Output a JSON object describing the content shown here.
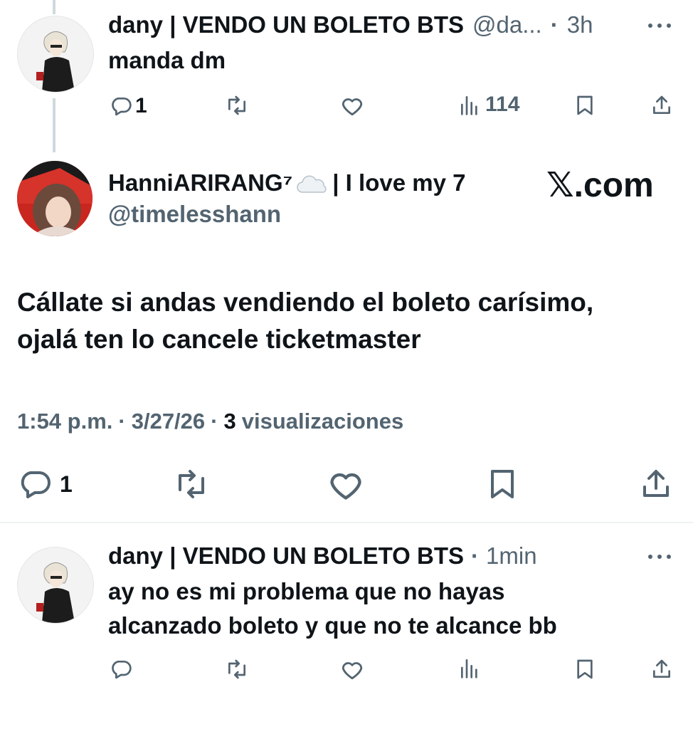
{
  "tweet1": {
    "display_name": "dany | VENDO UN BOLETO BTS",
    "handle": "@da...",
    "separator": "·",
    "time": "3h",
    "text": "manda dm",
    "reply_count": "1",
    "views": "114"
  },
  "main": {
    "display_name": "HanniARIRANG⁷",
    "name_suffix": "| I love my 7",
    "handle": "@timelesshann",
    "watermark": "𝕏.com",
    "text_line1": "Cállate si andas vendiendo el boleto carísimo,",
    "text_line2": "ojalá ten lo cancele ticketmaster",
    "time": "1:54 p.m.",
    "sep1": "·",
    "date": "3/27/26",
    "sep2": "·",
    "views_count": "3",
    "views_label": "visualizaciones",
    "reply_count": "1"
  },
  "tweet3": {
    "display_name": "dany | VENDO UN BOLETO BTS",
    "separator": "·",
    "time": "1min",
    "text_line1": "ay no es mi problema que no hayas",
    "text_line2": "alcanzado boleto y que no te alcance bb"
  },
  "colors": {
    "text": "#0f1419",
    "secondary": "#536471",
    "divider": "#eff3f4",
    "thread_line": "#cfd9de"
  }
}
